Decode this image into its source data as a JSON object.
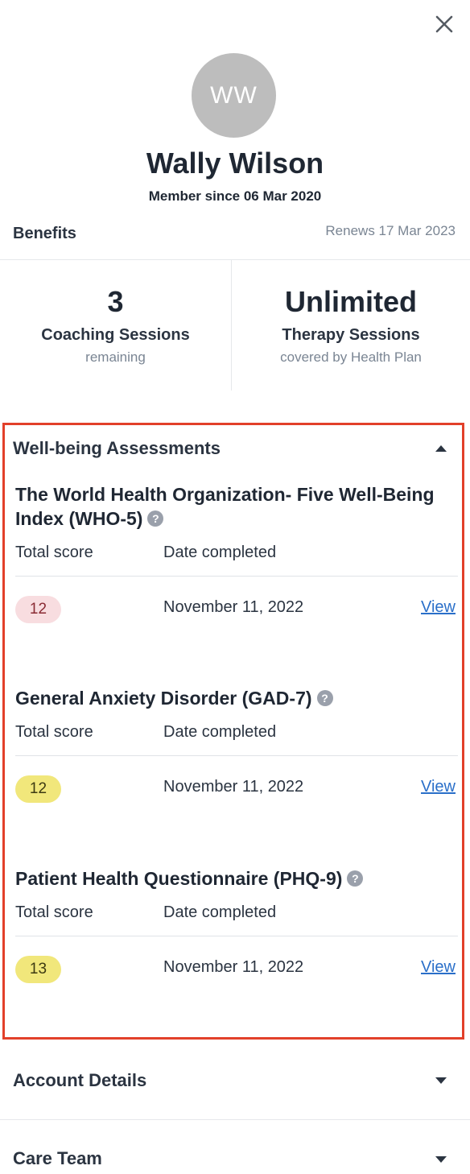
{
  "header": {
    "close_icon": "close-icon",
    "avatar_initials": "WW",
    "name": "Wally Wilson",
    "member_since": "Member since 06 Mar 2020"
  },
  "benefits": {
    "title": "Benefits",
    "renews": "Renews 17 Mar 2023",
    "items": [
      {
        "value": "3",
        "label": "Coaching Sessions",
        "sub": "remaining"
      },
      {
        "value": "Unlimited",
        "label": "Therapy Sessions",
        "sub": "covered by Health Plan"
      }
    ]
  },
  "wellbeing": {
    "title": "Well-being Assessments",
    "assessments": [
      {
        "title": "The World Health Organization- Five Well-Being Index (WHO-5)",
        "col_score": "Total score",
        "col_date": "Date completed",
        "score": "12",
        "score_color": "#f8dde0",
        "date": "November 11, 2022",
        "view": "View"
      },
      {
        "title": "General Anxiety Disorder (GAD-7)",
        "col_score": "Total score",
        "col_date": "Date completed",
        "score": "12",
        "score_color": "#f1e77b",
        "date": "November 11, 2022",
        "view": "View"
      },
      {
        "title": "Patient Health Questionnaire (PHQ-9)",
        "col_score": "Total score",
        "col_date": "Date completed",
        "score": "13",
        "score_color": "#f1e77b",
        "date": "November 11, 2022",
        "view": "View"
      }
    ]
  },
  "sections": {
    "account_details": "Account Details",
    "care_team": "Care Team"
  },
  "colors": {
    "highlight_border": "#e2402a",
    "link": "#2a6fc9",
    "help_icon": "#9aa0ab"
  }
}
